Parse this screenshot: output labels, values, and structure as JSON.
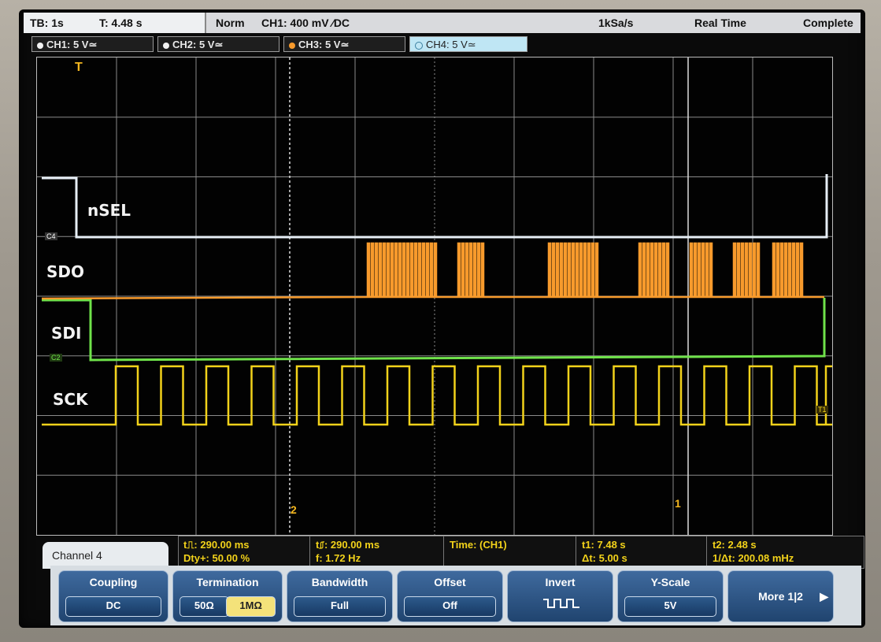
{
  "topbar": {
    "timebase": "TB: 1s",
    "trigger_time": "T: 4.48 s",
    "mode": "Norm",
    "ch1_setting": "CH1: 400 mV ∕DC",
    "sample_rate": "1kSa/s",
    "acq_mode": "Real Time",
    "status": "Complete"
  },
  "channels": [
    {
      "label": "CH1: 5 V≃",
      "color": "#f2d21a"
    },
    {
      "label": "CH2: 5 V≃",
      "color": "#6fe24a"
    },
    {
      "label": "CH3: 5 V≃",
      "color": "#f79a2c"
    },
    {
      "label": "CH4: 5 V≃",
      "color": "#9fd8ea"
    }
  ],
  "signals": {
    "nsel": "nSEL",
    "sdo": "SDO",
    "sdi": "SDI",
    "sck": "SCK"
  },
  "markers": {
    "trigger": "T",
    "cursor2": "2",
    "cursor1": "1",
    "ch4_ref": "C4",
    "ch2_ref": "C2",
    "ch1_ref": "T1"
  },
  "measurements": {
    "pos_width": "t⎍: 290.00 ms",
    "duty": "Dty+: 50.00 %",
    "neg_width": "t⎎: 290.00 ms",
    "freq": "f: 1.72 Hz",
    "time_src": "Time: (CH1)",
    "t1": "t1: 7.48 s",
    "delta_t": "Δt: 5.00 s",
    "t2": "t2: 2.48 s",
    "inv_delta_t": "1/Δt: 200.08 mHz"
  },
  "menu_title": "Channel 4",
  "softkeys": {
    "coupling": {
      "label": "Coupling",
      "value": "DC"
    },
    "termination": {
      "label": "Termination",
      "opt1": "50Ω",
      "opt2": "1MΩ"
    },
    "bandwidth": {
      "label": "Bandwidth",
      "value": "Full"
    },
    "offset": {
      "label": "Offset",
      "value": "Off"
    },
    "invert": {
      "label": "Invert"
    },
    "yscale": {
      "label": "Y-Scale",
      "value": "5V"
    },
    "more": {
      "label": "More 1|2"
    }
  },
  "colors": {
    "ch1": "#f2d21a",
    "ch2": "#6fe24a",
    "ch3": "#f79a2c",
    "ch4": "#e6eef6",
    "grid": "#8a8a8a"
  }
}
